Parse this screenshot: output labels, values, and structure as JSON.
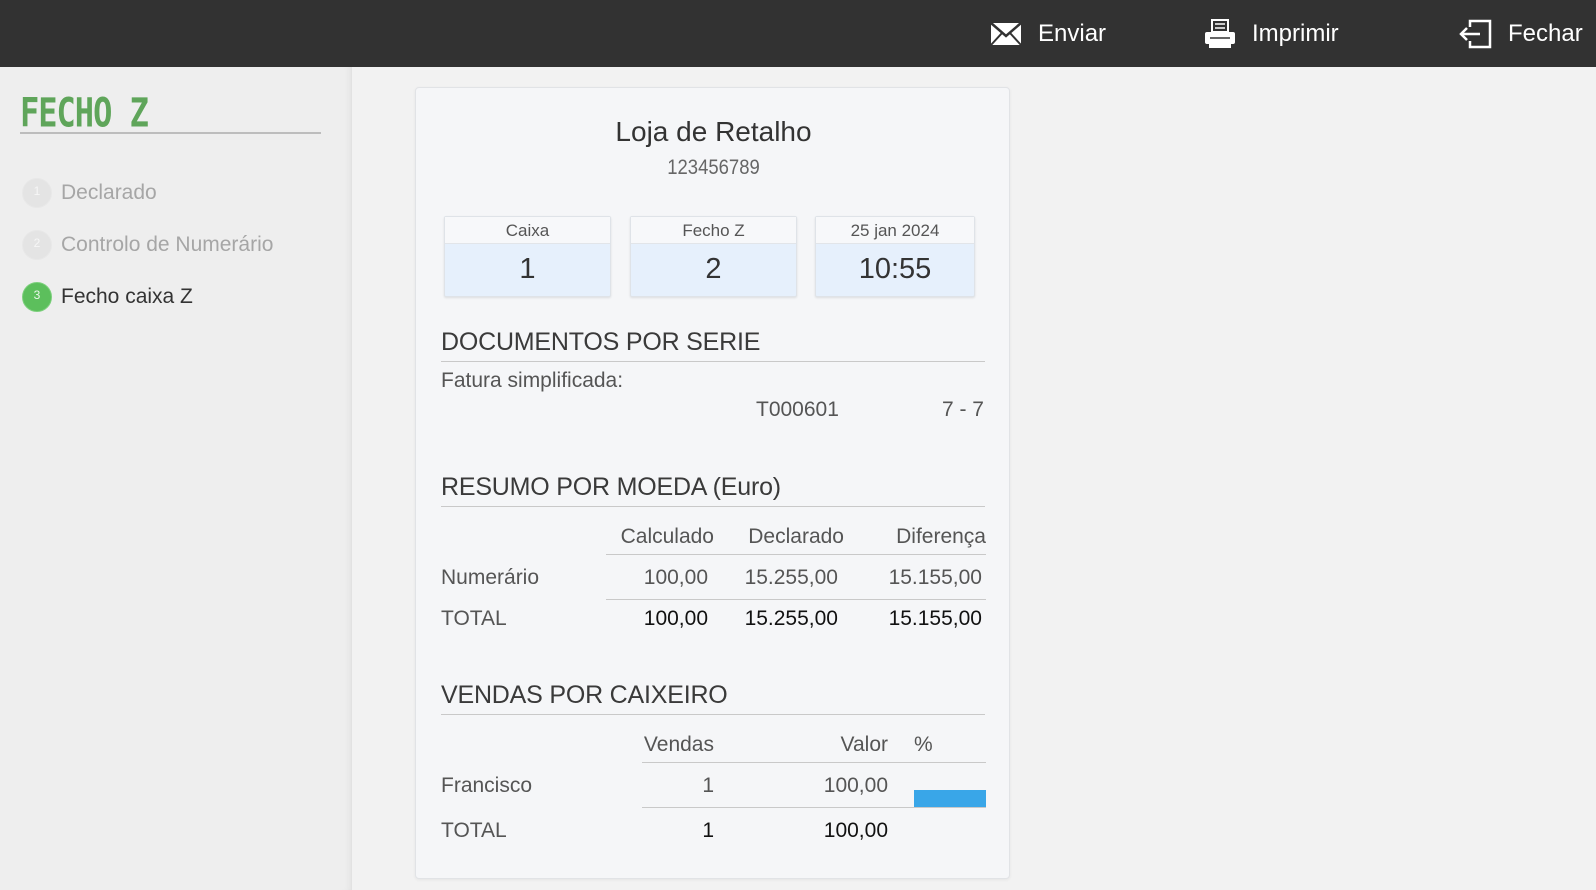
{
  "topbar": {
    "actions": [
      {
        "label": "Enviar",
        "icon": "envelope-icon"
      },
      {
        "label": "Imprimir",
        "icon": "printer-icon"
      },
      {
        "label": "Fechar",
        "icon": "exit-icon"
      }
    ]
  },
  "sidebar": {
    "title": "FECHO Z",
    "steps": [
      {
        "number": "1",
        "label": "Declarado",
        "active": false
      },
      {
        "number": "2",
        "label": "Controlo de Numerário",
        "active": false
      },
      {
        "number": "3",
        "label": "Fecho caixa Z",
        "active": true
      }
    ]
  },
  "report": {
    "store_name": "Loja de Retalho",
    "store_nif": "123456789",
    "info": {
      "caixa_label": "Caixa",
      "caixa_value": "1",
      "fecho_label": "Fecho Z",
      "fecho_value": "2",
      "date_label": "25 jan 2024",
      "time_value": "10:55"
    },
    "documents": {
      "title": "DOCUMENTOS POR SERIE",
      "type_label": "Fatura simplificada:",
      "series": "T000601",
      "range": "7 - 7"
    },
    "currency": {
      "title": "RESUMO POR MOEDA (Euro)",
      "headers": [
        "Calculado",
        "Declarado",
        "Diferença"
      ],
      "rows": [
        {
          "label": "Numerário",
          "calculado": "100,00",
          "declarado": "15.255,00",
          "diferenca": "15.155,00"
        }
      ],
      "total": {
        "label": "TOTAL",
        "calculado": "100,00",
        "declarado": "15.255,00",
        "diferenca": "15.155,00"
      }
    },
    "cashier": {
      "title": "VENDAS POR CAIXEIRO",
      "headers": [
        "Vendas",
        "Valor",
        "%"
      ],
      "rows": [
        {
          "name": "Francisco",
          "vendas": "1",
          "valor": "100,00",
          "percent": 100
        }
      ],
      "total": {
        "label": "TOTAL",
        "vendas": "1",
        "valor": "100,00"
      }
    }
  },
  "colors": {
    "topbar": "#323232",
    "accent_green": "#5fa55a",
    "step_active": "#5cbf5c",
    "bar_blue": "#39a6e8"
  }
}
